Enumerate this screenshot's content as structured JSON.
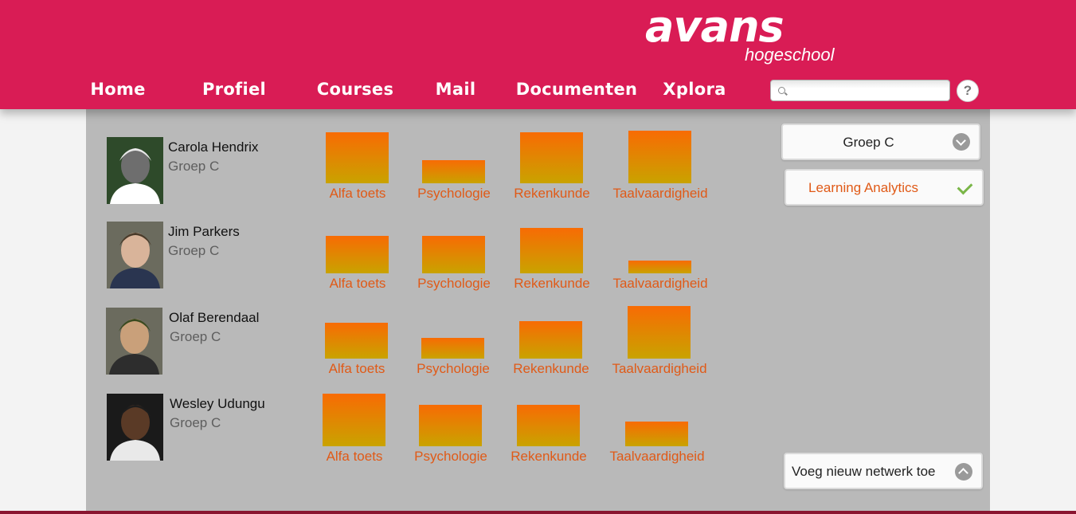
{
  "logo": {
    "main": "avans",
    "sub": "hogeschool"
  },
  "nav": [
    {
      "label": "Home"
    },
    {
      "label": "Profiel"
    },
    {
      "label": "Courses"
    },
    {
      "label": "Mail"
    },
    {
      "label": "Documenten"
    },
    {
      "label": "Xplora"
    }
  ],
  "search": {
    "placeholder": "",
    "value": ""
  },
  "help": {
    "label": "?"
  },
  "colors": {
    "header": "#d91c55",
    "panel": "#b9b9b9",
    "bar_top": "#f86b04",
    "bar_bottom": "#c9a300",
    "label_orange": "#e05a17",
    "check_green": "#7ab648"
  },
  "sidebar": {
    "group_select": {
      "label": "Groep C",
      "icon": "chevron-down-icon"
    },
    "analytics_button": {
      "label": "Learning Analytics",
      "icon": "checkmark-icon"
    },
    "add_network_button": {
      "label": "Voeg nieuw netwerk toe",
      "icon": "chevron-up-icon"
    }
  },
  "students": [
    {
      "name": "Carola Hendrix",
      "group": "Groep C",
      "scores": [
        {
          "course": "Alfa toets",
          "value": 0.62
        },
        {
          "course": "Psychologie",
          "value": 0.28
        },
        {
          "course": "Rekenkunde",
          "value": 0.62
        },
        {
          "course": "Taalvaardigheid",
          "value": 0.63
        }
      ]
    },
    {
      "name": "Jim Parkers",
      "group": "Groep C",
      "scores": [
        {
          "course": "Alfa toets",
          "value": 0.45
        },
        {
          "course": "Psychologie",
          "value": 0.45
        },
        {
          "course": "Rekenkunde",
          "value": 0.55
        },
        {
          "course": "Taalvaardigheid",
          "value": 0.15
        }
      ]
    },
    {
      "name": "Olaf Berendaal",
      "group": "Groep C",
      "scores": [
        {
          "course": "Alfa toets",
          "value": 0.43
        },
        {
          "course": "Psychologie",
          "value": 0.25
        },
        {
          "course": "Rekenkunde",
          "value": 0.45
        },
        {
          "course": "Taalvaardigheid",
          "value": 0.63
        }
      ]
    },
    {
      "name": "Wesley Udungu",
      "group": "Groep C",
      "scores": [
        {
          "course": "Alfa toets",
          "value": 0.63
        },
        {
          "course": "Psychologie",
          "value": 0.5
        },
        {
          "course": "Rekenkunde",
          "value": 0.5
        },
        {
          "course": "Taalvaardigheid",
          "value": 0.3
        }
      ]
    }
  ]
}
